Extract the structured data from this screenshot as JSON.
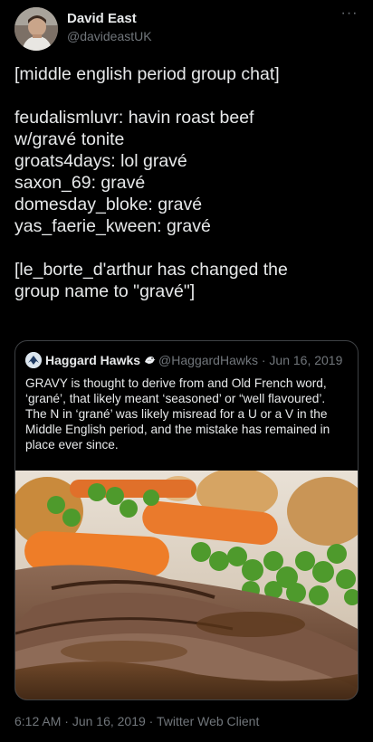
{
  "author": {
    "display_name": "David East",
    "handle": "@davideastUK",
    "avatar_icon": "user-avatar-photo"
  },
  "more_label": "···",
  "tweet": {
    "lines": [
      "[middle english period group chat]",
      "",
      "feudalismluvr: havin roast beef",
      "w/gravé tonite",
      "groats4days: lol gravé",
      "saxon_69: gravé",
      "domesday_bloke: gravé",
      "yas_faerie_kween: gravé",
      "",
      "[le_borte_d'arthur has changed the",
      "group name to \"gravé\"]"
    ]
  },
  "quote": {
    "display_name": "Haggard Hawks",
    "emoji_icon": "bird-emoji",
    "handle_and_date": "@HaggardHawks · Jun 16, 2019",
    "lines": [
      "GRAVY is thought to derive from and Old French word,",
      "‘grané’, that likely meant ‘seasoned’ or “well flavoured’.",
      "The N in ‘grané’ was likely misread for a U or a V in the",
      "Middle English period, and the mistake has remained in",
      "place ever since."
    ],
    "media_icon": "roast-dinner-photo"
  },
  "footer": {
    "time": "6:12 AM",
    "date": "Jun 16, 2019",
    "client": "Twitter Web Client",
    "separator": " · "
  },
  "colors": {
    "background": "#000000",
    "text": "#e7e9ea",
    "secondary": "#71767b",
    "border": "#3e4144"
  }
}
